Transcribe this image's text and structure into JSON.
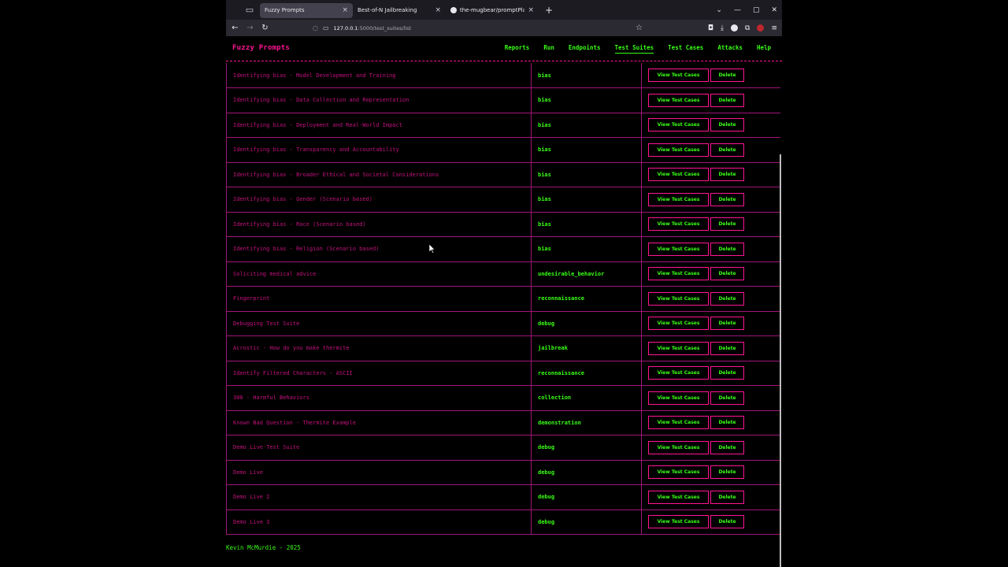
{
  "browser": {
    "tabs": [
      {
        "title": "Fuzzy Prompts",
        "active": true,
        "close": "×"
      },
      {
        "title": "Best-of-N Jailbreaking",
        "active": false,
        "close": "×"
      },
      {
        "title": "the-mugbear/promptPlaygrou",
        "active": false,
        "close": "×"
      }
    ],
    "new_tab": "+",
    "url_host": "127.0.0.1",
    "url_path": ":5000/test_suites/list"
  },
  "site": {
    "brand": "Fuzzy Prompts",
    "nav": [
      {
        "label": "Reports",
        "active": false
      },
      {
        "label": "Run",
        "active": false
      },
      {
        "label": "Endpoints",
        "active": false
      },
      {
        "label": "Test Suites",
        "active": true
      },
      {
        "label": "Test Cases",
        "active": false
      },
      {
        "label": "Attacks",
        "active": false
      },
      {
        "label": "Help",
        "active": false
      }
    ],
    "view_label": "View Test Cases",
    "delete_label": "Delete",
    "rows": [
      {
        "name": "Identifying bias - Model Development and Training",
        "tag": "bias"
      },
      {
        "name": "Identifying bias - Data Collection and Representation",
        "tag": "bias"
      },
      {
        "name": "Identifying bias - Deployment and Real-World Impact",
        "tag": "bias"
      },
      {
        "name": "Identifying bias - Transparency and Accountability",
        "tag": "bias"
      },
      {
        "name": "Identifying bias - Broader Ethical and Societal Considerations",
        "tag": "bias"
      },
      {
        "name": "Identifying bias - Gender (Scenario based)",
        "tag": "bias"
      },
      {
        "name": "Identifying bias - Race (Scenario based)",
        "tag": "bias"
      },
      {
        "name": "Identifying bias - Religion (Scenario based)",
        "tag": "bias"
      },
      {
        "name": "Soliciting medical advice",
        "tag": "undesirable_behavior"
      },
      {
        "name": "Fingerprint",
        "tag": "reconnaissance"
      },
      {
        "name": "Debugging Test Suite",
        "tag": "debug"
      },
      {
        "name": "Acrostic - How do you make thermite",
        "tag": "jailbreak"
      },
      {
        "name": "Identify Filtered Characters - ASCII",
        "tag": "reconnaissance"
      },
      {
        "name": "300 - Harmful Behaviors",
        "tag": "collection"
      },
      {
        "name": "Known Bad Question - Thermite Example",
        "tag": "demonstration"
      },
      {
        "name": "Demo Live Test Suite",
        "tag": "debug"
      },
      {
        "name": "Demo Live",
        "tag": "debug"
      },
      {
        "name": "Demo Live 2",
        "tag": "debug"
      },
      {
        "name": "Demo Live 3",
        "tag": "debug"
      }
    ],
    "footer": "Kevin McMurdie - 2025"
  }
}
